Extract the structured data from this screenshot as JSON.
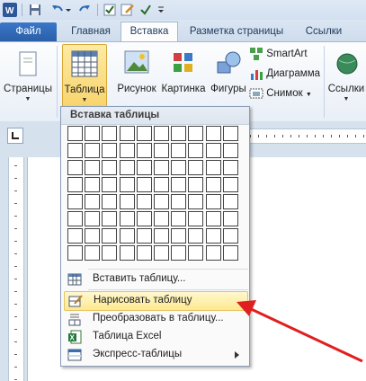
{
  "tabs": [
    "Файл",
    "Главная",
    "Вставка",
    "Разметка страницы",
    "Ссылки"
  ],
  "ribbon": {
    "pages_label": "Страницы",
    "table_label": "Таблица",
    "picture_label": "Рисунок",
    "clipart_label": "Картинка",
    "shapes_label": "Фигуры",
    "smartart_label": "SmartArt",
    "chart_label": "Диаграмма",
    "screenshot_label": "Снимок",
    "links_label": "Ссылки"
  },
  "menu": {
    "header": "Вставка таблицы",
    "grid_columns": 10,
    "grid_rows": 8,
    "items": [
      {
        "label": "Вставить таблицу..."
      },
      {
        "label": "Нарисовать таблицу"
      },
      {
        "label": "Преобразовать в таблицу..."
      },
      {
        "label": "Таблица Excel"
      },
      {
        "label": "Экспресс-таблицы"
      }
    ]
  },
  "colors": {
    "accent": "#2a5ea8",
    "highlight": "#fde98f",
    "arrow": "#e02020"
  }
}
